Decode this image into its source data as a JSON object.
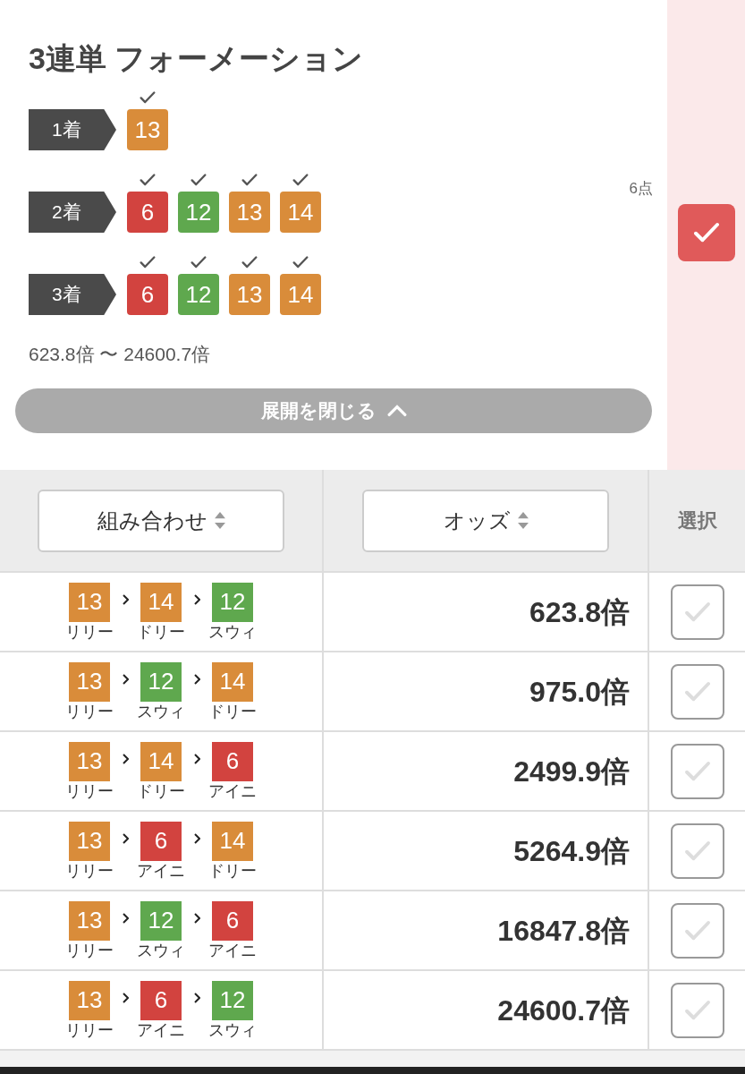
{
  "title": "3連単 フォーメーション",
  "positions": [
    {
      "label": "1着",
      "horses": [
        {
          "number": "13",
          "color": "#d98c3a",
          "checked": true
        }
      ]
    },
    {
      "label": "2着",
      "horses": [
        {
          "number": "6",
          "color": "#d2433f",
          "checked": true
        },
        {
          "number": "12",
          "color": "#5fa84e",
          "checked": true
        },
        {
          "number": "13",
          "color": "#d98c3a",
          "checked": true
        },
        {
          "number": "14",
          "color": "#d98c3a",
          "checked": true
        }
      ]
    },
    {
      "label": "3着",
      "horses": [
        {
          "number": "6",
          "color": "#d2433f",
          "checked": true
        },
        {
          "number": "12",
          "color": "#5fa84e",
          "checked": true
        },
        {
          "number": "13",
          "color": "#d98c3a",
          "checked": true
        },
        {
          "number": "14",
          "color": "#d98c3a",
          "checked": true
        }
      ]
    }
  ],
  "count": "6点",
  "all_selected": true,
  "odds_range": "623.8倍 〜 24600.7倍",
  "collapse_button": "展開を閉じる",
  "columns": [
    {
      "label": "組み合わせ",
      "sortable": true
    },
    {
      "label": "オッズ",
      "sortable": true
    },
    {
      "label": "選択",
      "sortable": false
    }
  ],
  "rows": [
    {
      "horses": [
        {
          "number": "13",
          "name": "リリー",
          "color": "#d98c3a"
        },
        {
          "number": "14",
          "name": "ドリー",
          "color": "#d98c3a"
        },
        {
          "number": "12",
          "name": "スウィ",
          "color": "#5fa84e"
        }
      ],
      "odds": "623.8倍",
      "selected": false
    },
    {
      "horses": [
        {
          "number": "13",
          "name": "リリー",
          "color": "#d98c3a"
        },
        {
          "number": "12",
          "name": "スウィ",
          "color": "#5fa84e"
        },
        {
          "number": "14",
          "name": "ドリー",
          "color": "#d98c3a"
        }
      ],
      "odds": "975.0倍",
      "selected": false
    },
    {
      "horses": [
        {
          "number": "13",
          "name": "リリー",
          "color": "#d98c3a"
        },
        {
          "number": "14",
          "name": "ドリー",
          "color": "#d98c3a"
        },
        {
          "number": "6",
          "name": "アイニ",
          "color": "#d2433f"
        }
      ],
      "odds": "2499.9倍",
      "selected": false
    },
    {
      "horses": [
        {
          "number": "13",
          "name": "リリー",
          "color": "#d98c3a"
        },
        {
          "number": "6",
          "name": "アイニ",
          "color": "#d2433f"
        },
        {
          "number": "14",
          "name": "ドリー",
          "color": "#d98c3a"
        }
      ],
      "odds": "5264.9倍",
      "selected": false
    },
    {
      "horses": [
        {
          "number": "13",
          "name": "リリー",
          "color": "#d98c3a"
        },
        {
          "number": "12",
          "name": "スウィ",
          "color": "#5fa84e"
        },
        {
          "number": "6",
          "name": "アイニ",
          "color": "#d2433f"
        }
      ],
      "odds": "16847.8倍",
      "selected": false
    },
    {
      "horses": [
        {
          "number": "13",
          "name": "リリー",
          "color": "#d98c3a"
        },
        {
          "number": "6",
          "name": "アイニ",
          "color": "#d2433f"
        },
        {
          "number": "12",
          "name": "スウィ",
          "color": "#5fa84e"
        }
      ],
      "odds": "24600.7倍",
      "selected": false
    }
  ]
}
